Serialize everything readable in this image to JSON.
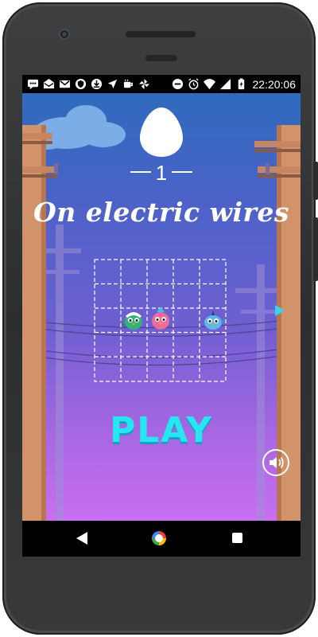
{
  "status_bar": {
    "time": "22:20:06",
    "left_icons": [
      "chat-bubble-icon",
      "mail-icon",
      "gmail-icon",
      "vpn-shield-icon",
      "download-icon",
      "navigation-icon",
      "coffee-cup-icon",
      "pinwheel-icon"
    ],
    "right_icons": [
      "do-not-disturb-icon",
      "alarm-icon",
      "wifi-icon",
      "signal-icon",
      "battery-charging-icon"
    ]
  },
  "game": {
    "level_number": "1",
    "level_title": "On electric wires",
    "play_label": "PLAY",
    "grid": {
      "columns": 5,
      "rows": 5
    },
    "birds": [
      {
        "color": "green",
        "column": 2,
        "row": 3
      },
      {
        "color": "pink",
        "column": 3,
        "row": 3
      },
      {
        "color": "blue",
        "column": 5,
        "row": 3
      }
    ],
    "colors": {
      "sky_top": "#2f6bbd",
      "sky_bottom": "#c86ff0",
      "play_text": "#27e6f2",
      "pole": "#d2926a",
      "egg": "#ffffff"
    }
  },
  "nav_bar": {
    "buttons": [
      "back-triangle-icon",
      "home-circle-icon",
      "recents-square-icon"
    ]
  }
}
